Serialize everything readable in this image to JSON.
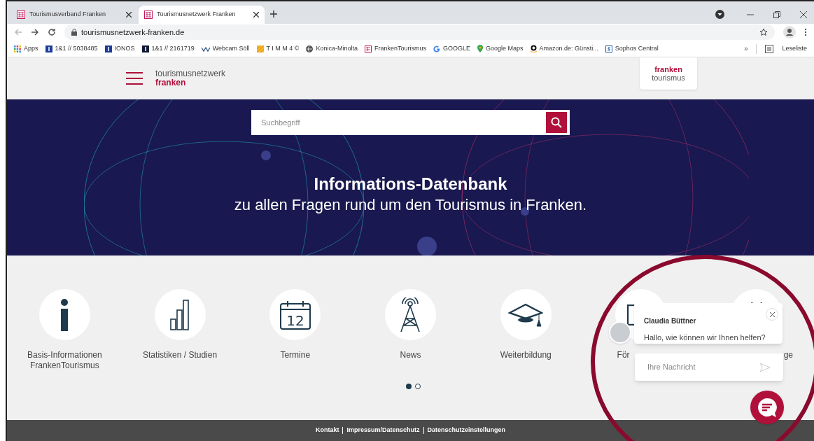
{
  "tabs": [
    {
      "title": "Tourismusverband Franken",
      "selected": false
    },
    {
      "title": "Tourismusnetzwerk Franken",
      "selected": true
    }
  ],
  "address": "tourismusnetzwerk-franken.de",
  "bookmarks": [
    {
      "label": "Apps",
      "kind": "apps"
    },
    {
      "label": "1&1 // 5038485",
      "kind": "blue"
    },
    {
      "label": "IONOS",
      "kind": "blue"
    },
    {
      "label": "1&1 // 2161719",
      "kind": "dark"
    },
    {
      "label": "Webcam Söll",
      "kind": "wave"
    },
    {
      "label": "T I M M 4 ©",
      "kind": "stripes"
    },
    {
      "label": "Konica-Minolta",
      "kind": "globe"
    },
    {
      "label": "FrankenTourismus",
      "kind": "franken"
    },
    {
      "label": "GOOGLE",
      "kind": "g"
    },
    {
      "label": "Google Maps",
      "kind": "pin"
    },
    {
      "label": "Amazon.de: Günsti...",
      "kind": "amazon"
    },
    {
      "label": "Sophos Central",
      "kind": "s"
    }
  ],
  "overflow_chevron": "»",
  "reading_list": "Leseliste",
  "site": {
    "brand_top": "tourismusnetzwerk",
    "brand_bottom": "franken",
    "logo_top": "franken",
    "logo_bottom": "tourismus"
  },
  "hero": {
    "search_placeholder": "Suchbegriff",
    "title": "Informations-Datenbank",
    "subtitle": "zu allen Fragen rund um den Tourismus in Franken."
  },
  "categories": [
    {
      "label": "Basis-Informationen FrankenTourismus",
      "kind": "full"
    },
    {
      "label": "Statistiken / Studien",
      "kind": "full"
    },
    {
      "label": "Termine",
      "kind": "full"
    },
    {
      "label": "News",
      "kind": "full"
    },
    {
      "label": "Weiterbildung",
      "kind": "full"
    },
    {
      "label": "För",
      "kind": "cut_end"
    },
    {
      "label": "ge",
      "kind": "cut_start"
    }
  ],
  "calendar_day": "12",
  "carousel_dots": [
    {
      "selected": true
    },
    {
      "selected": false
    }
  ],
  "chat": {
    "agent": "Claudia Büttner",
    "message": "Hallo, wie können wir Ihnen helfen?",
    "placeholder": "Ihre Nachricht"
  },
  "footer_links": [
    "Kontakt",
    "Impressum/Datenschutz",
    "Datenschutzeinstellungen"
  ]
}
